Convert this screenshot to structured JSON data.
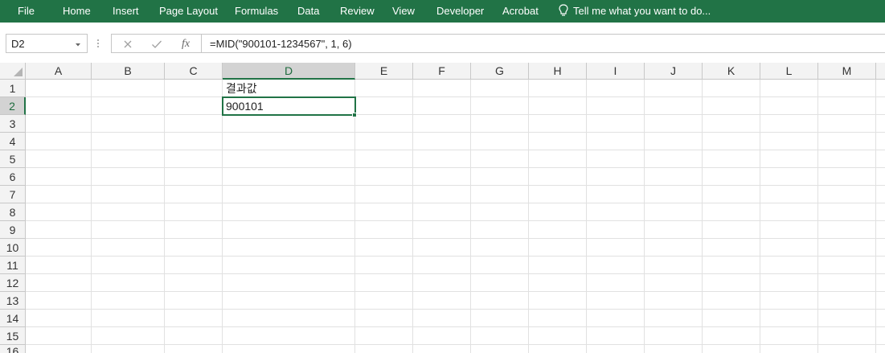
{
  "ribbon": {
    "tabs": [
      "File",
      "Home",
      "Insert",
      "Page Layout",
      "Formulas",
      "Data",
      "Review",
      "View",
      "Developer",
      "Acrobat"
    ],
    "tell_me": "Tell me what you want to do..."
  },
  "formula_bar": {
    "name_box": "D2",
    "fx_label": "fx",
    "formula": "=MID(\"900101-1234567\", 1, 6)"
  },
  "sheet": {
    "columns": [
      "A",
      "B",
      "C",
      "D",
      "E",
      "F",
      "G",
      "H",
      "I",
      "J",
      "K",
      "L",
      "M"
    ],
    "rows": [
      "1",
      "2",
      "3",
      "4",
      "5",
      "6",
      "7",
      "8",
      "9",
      "10",
      "11",
      "12",
      "13",
      "14",
      "15",
      "16"
    ],
    "active_cell": "D2",
    "cells": {
      "D1": "결과값",
      "D2": "900101"
    }
  },
  "colors": {
    "accent": "#217346"
  }
}
